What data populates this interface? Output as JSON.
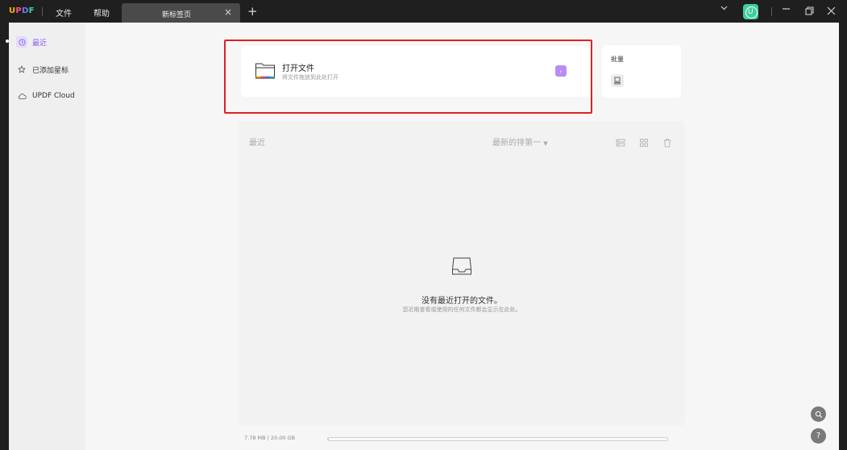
{
  "app": {
    "logo": {
      "letters": [
        "U",
        "P",
        "D",
        "F"
      ],
      "colors": [
        "#ffb400",
        "#ff4f8b",
        "#6a7bff",
        "#3cd6a0"
      ]
    },
    "menu": {
      "file": "文件",
      "help": "帮助"
    },
    "tab": {
      "label": "新标签页",
      "close": "×"
    },
    "add_tab": "+",
    "user": {
      "initial": "U",
      "color": "#3ccf9a"
    }
  },
  "sidebar": {
    "items": [
      {
        "label": "最近",
        "icon": "clock-icon",
        "active": true
      },
      {
        "label": "已添加星标",
        "icon": "star-icon",
        "active": false
      },
      {
        "label": "UPDF Cloud",
        "icon": "cloud-icon",
        "active": false
      }
    ]
  },
  "open_file": {
    "title": "打开文件",
    "subtitle": "将文件拖放到此处打开",
    "arrow": "›"
  },
  "batch": {
    "title": "批量"
  },
  "recent": {
    "title": "最近",
    "sort_label": "最新的排第一",
    "empty_title": "没有最近打开的文件。",
    "empty_subtitle": "您近期查看或使用的任何文件都会显示在此处。"
  },
  "storage": {
    "text": "7.78 MB | 20.00 GB",
    "used_fraction": 0.0004
  },
  "colors": {
    "accent": "#8b5cf6",
    "highlight": "#e02020"
  }
}
